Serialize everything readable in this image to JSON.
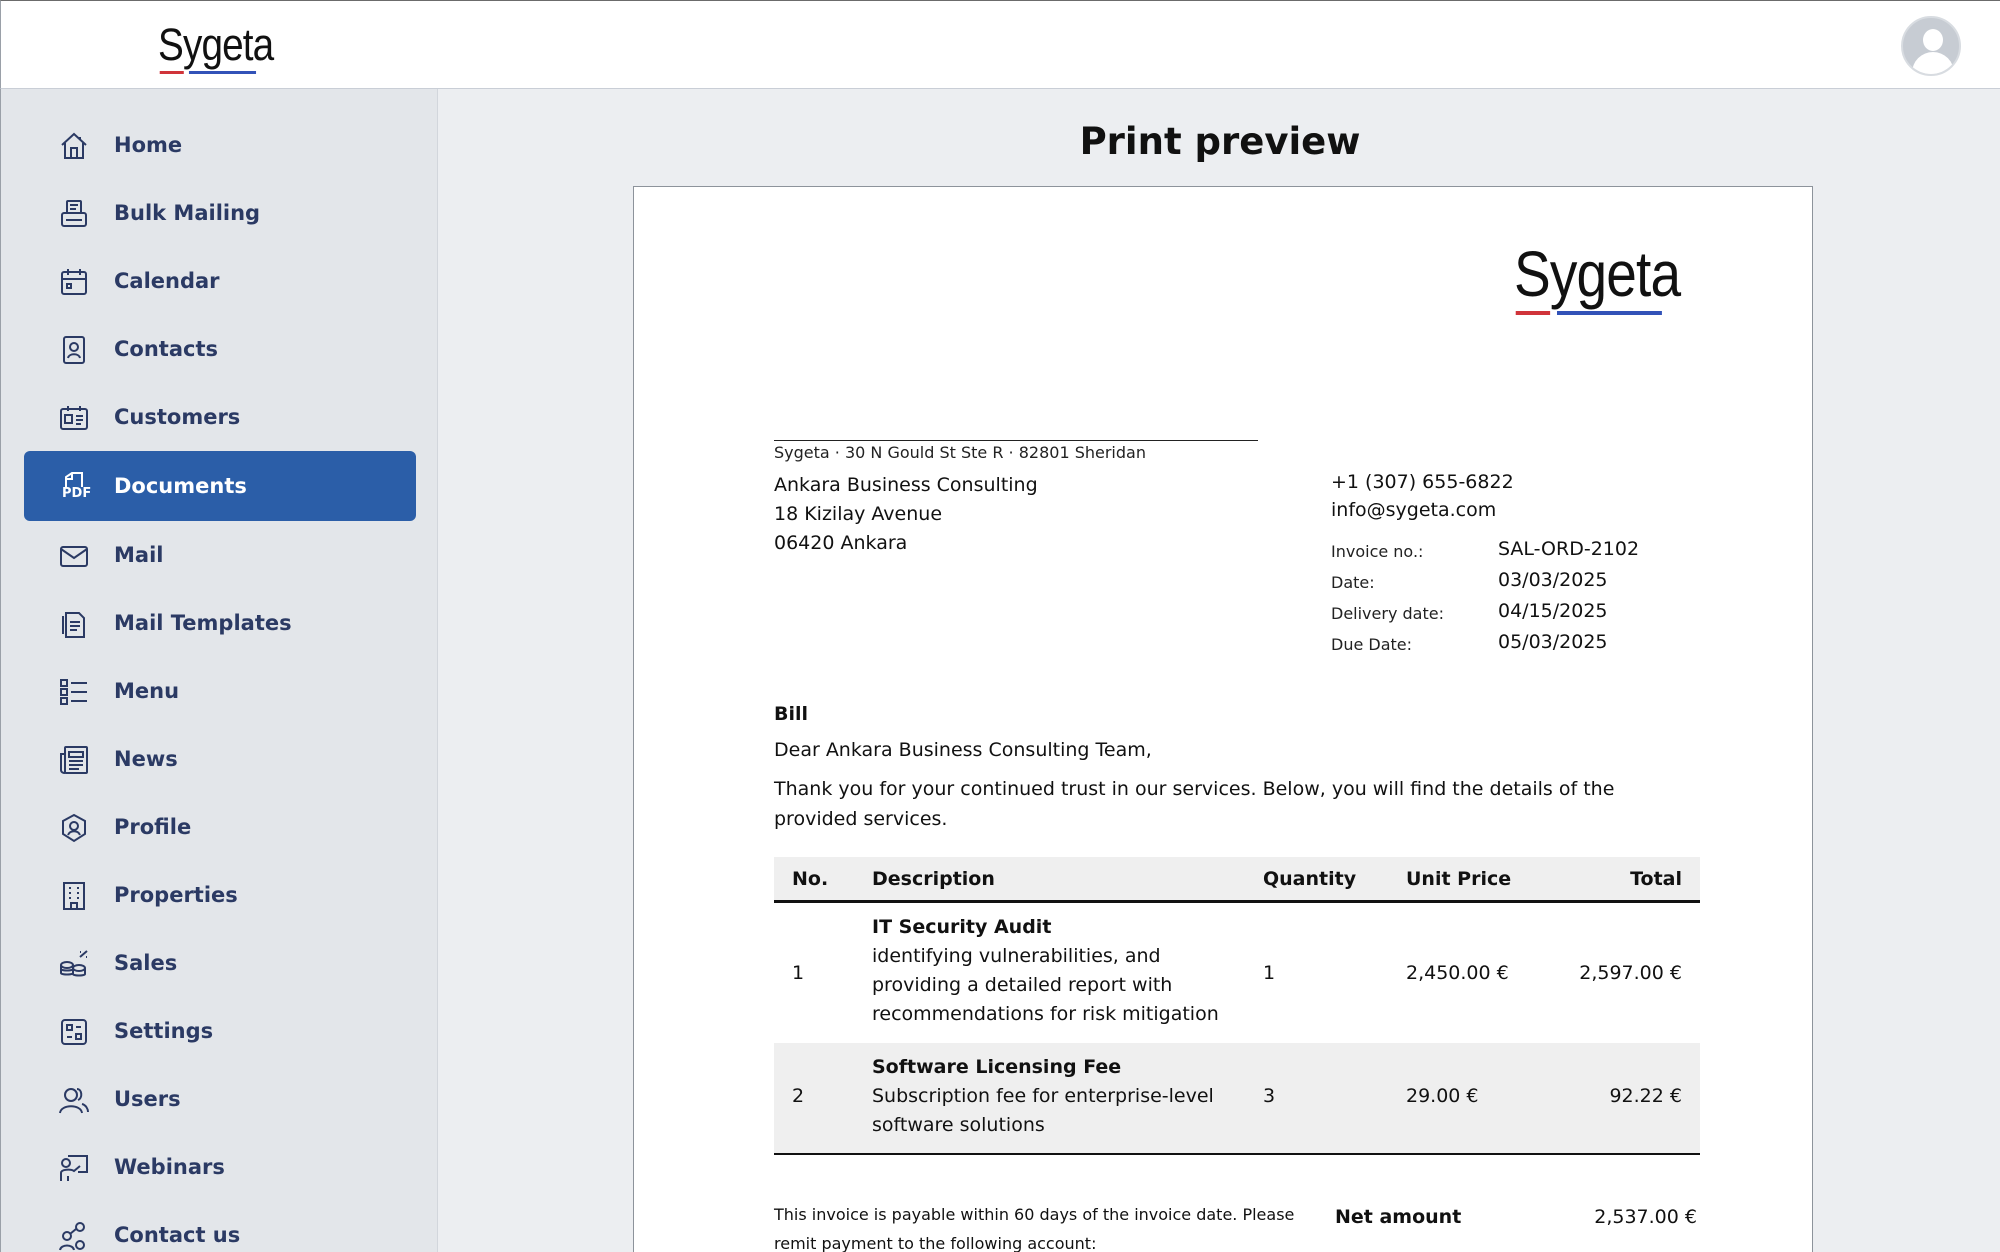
{
  "header": {
    "logo_text": "Sygeta"
  },
  "sidebar": {
    "items": [
      {
        "label": "Home",
        "icon": "home-icon"
      },
      {
        "label": "Bulk Mailing",
        "icon": "printer-icon"
      },
      {
        "label": "Calendar",
        "icon": "calendar-icon"
      },
      {
        "label": "Contacts",
        "icon": "contact-card-icon"
      },
      {
        "label": "Customers",
        "icon": "id-card-icon"
      },
      {
        "label": "Documents",
        "icon": "pdf-icon",
        "active": true
      },
      {
        "label": "Mail",
        "icon": "mail-icon"
      },
      {
        "label": "Mail Templates",
        "icon": "document-icon"
      },
      {
        "label": "Menu",
        "icon": "list-icon"
      },
      {
        "label": "News",
        "icon": "newspaper-icon"
      },
      {
        "label": "Profile",
        "icon": "profile-shield-icon"
      },
      {
        "label": "Properties",
        "icon": "building-icon"
      },
      {
        "label": "Sales",
        "icon": "coins-icon"
      },
      {
        "label": "Settings",
        "icon": "settings-panel-icon"
      },
      {
        "label": "Users",
        "icon": "users-icon"
      },
      {
        "label": "Webinars",
        "icon": "presentation-icon"
      },
      {
        "label": "Contact us",
        "icon": "contact-network-icon"
      }
    ],
    "pdf_label": "PDF"
  },
  "main": {
    "title": "Print preview"
  },
  "invoice": {
    "logo_text": "Sygeta",
    "sender": "Sygeta  ·  30 N Gould St Ste R  · 82801 Sheridan",
    "recipient": {
      "name": "Ankara Business Consulting",
      "street": "18 Kizilay Avenue",
      "city": "06420 Ankara"
    },
    "phone": "+1 (307) 655-6822",
    "email": "info@sygeta.com",
    "meta": [
      {
        "key": "Invoice no.:",
        "value": "SAL-ORD-2102"
      },
      {
        "key": "Date:",
        "value": "03/03/2025"
      },
      {
        "key": "Delivery date:",
        "value": "04/15/2025"
      },
      {
        "key": "Due Date:",
        "value": "05/03/2025"
      }
    ],
    "heading": "Bill",
    "greeting": "Dear Ankara Business Consulting Team,",
    "intro": "Thank you for your continued trust in our services. Below, you will find the details of the provided services.",
    "columns": {
      "no": "No.",
      "description": "Description",
      "quantity": "Quantity",
      "unit_price": "Unit Price",
      "total": "Total"
    },
    "rows": [
      {
        "no": "1",
        "title": "IT Security Audit",
        "line1": "identifying vulnerabilities, and",
        "line2": "providing a detailed report with",
        "line3": "recommendations for risk mitigation",
        "quantity": "1",
        "unit_price": "2,450.00 €",
        "total": "2,597.00 €"
      },
      {
        "no": "2",
        "title": "Software Licensing Fee",
        "line1": "Subscription fee for enterprise-level",
        "line2": "software solutions",
        "quantity": "3",
        "unit_price": "29.00 €",
        "total": "92.22 €"
      }
    ],
    "payable_text": "This invoice is payable within 60 days of the invoice date. Please remit payment to the following account:",
    "net_label": "Net amount",
    "net_value": "2,537.00 €"
  }
}
